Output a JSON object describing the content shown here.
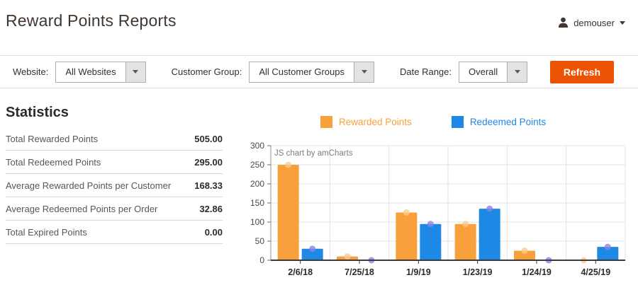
{
  "header": {
    "title": "Reward Points Reports",
    "user": {
      "name": "demouser"
    }
  },
  "filters": {
    "website": {
      "label": "Website:",
      "value": "All Websites"
    },
    "customer_group": {
      "label": "Customer Group:",
      "value": "All Customer Groups"
    },
    "date_range": {
      "label": "Date Range:",
      "value": "Overall"
    },
    "refresh_label": "Refresh"
  },
  "statistics": {
    "heading": "Statistics",
    "rows": [
      {
        "label": "Total Rewarded Points",
        "value": "505.00"
      },
      {
        "label": "Total Redeemed Points",
        "value": "295.00"
      },
      {
        "label": "Average Rewarded Points per Customer",
        "value": "168.33"
      },
      {
        "label": "Average Redeemed Points per Order",
        "value": "32.86"
      },
      {
        "label": "Total Expired Points",
        "value": "0.00"
      }
    ]
  },
  "chart_data": {
    "type": "bar",
    "title": "",
    "xlabel": "",
    "ylabel": "",
    "categories": [
      "2/6/18",
      "7/25/18",
      "1/9/19",
      "1/23/19",
      "1/24/19",
      "4/25/19"
    ],
    "series": [
      {
        "name": "Rewarded Points",
        "color": "#F8A13C",
        "bullet_color": "#FBCA8E",
        "values": [
          250,
          10,
          125,
          95,
          25,
          0
        ]
      },
      {
        "name": "Redeemed Points",
        "color": "#1E88E5",
        "bullet_color": "#8886E5",
        "values": [
          30,
          0,
          95,
          135,
          0,
          35
        ]
      }
    ],
    "ylim": [
      0,
      300
    ],
    "ytick_step": 50,
    "grid": true,
    "legend_position": "top",
    "watermark": "JS chart by amCharts"
  },
  "colors": {
    "accent_orange": "#EB5202",
    "title_text": "#41362F",
    "grid_line": "#E3E3E3",
    "axis_line": "#3A3A3A"
  }
}
